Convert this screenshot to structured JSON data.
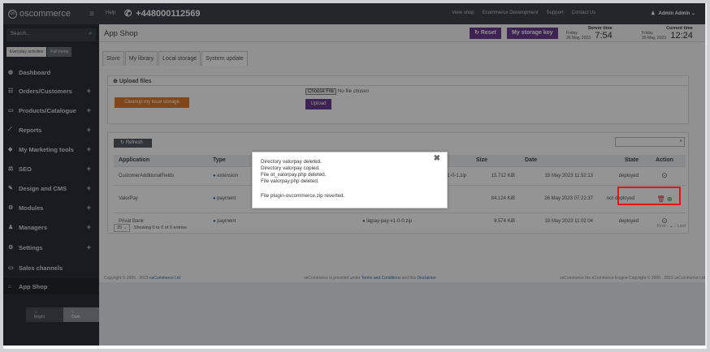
{
  "topbar": {
    "brand": "oscommerce",
    "logo": "os",
    "help": "Help",
    "phone": "+448000112569",
    "links": [
      "View shop",
      "Ecommerce Development",
      "Support",
      "Contact Us"
    ],
    "user": "Admin Admin"
  },
  "sidebar": {
    "search_placeholder": "Search...",
    "modes": [
      "Everyday activities",
      "Full menu"
    ],
    "items": [
      {
        "label": "Dashboard",
        "has_plus": false
      },
      {
        "label": "Orders/Customers",
        "has_plus": true
      },
      {
        "label": "Products/Catalogue",
        "has_plus": true
      },
      {
        "label": "Reports",
        "has_plus": true
      },
      {
        "label": "My Marketing tools",
        "has_plus": true
      },
      {
        "label": "SEO",
        "has_plus": true
      },
      {
        "label": "Design and CMS",
        "has_plus": true
      },
      {
        "label": "Modules",
        "has_plus": true
      },
      {
        "label": "Managers",
        "has_plus": true
      },
      {
        "label": "Settings",
        "has_plus": true
      },
      {
        "label": "Sales channels",
        "has_plus": false
      },
      {
        "label": "App Shop",
        "has_plus": false
      }
    ],
    "theme": {
      "bright": "Bright",
      "dark": "Dark"
    }
  },
  "page": {
    "title": "App Shop",
    "reset_label": "Reset",
    "storage_label": "My storage key",
    "server_time": {
      "label": "Server time",
      "day": "Friday",
      "date": "26 May, 2023",
      "time": "7:54"
    },
    "current_time": {
      "label": "Current time",
      "day": "Friday",
      "date": "26 May, 2023",
      "time": "12:24"
    }
  },
  "tabs": [
    "Store",
    "My library",
    "Local storage",
    "System update"
  ],
  "upload": {
    "heading": "Upload files",
    "cleanup_label": "Cleanup my local storage",
    "choose_label": "Choose File",
    "no_file": "No file chosen",
    "upload_label": "Upload"
  },
  "table": {
    "refresh_label": "Refresh",
    "columns": [
      "Application",
      "Type",
      "",
      "",
      "Size",
      "Date",
      "State",
      "Action"
    ],
    "rows": [
      {
        "application": "CustomerAdditionalFields",
        "type": "extension",
        "file": "s-ext-v1-0-1.zip",
        "size": "15.712 KiB",
        "date": "19 May 2023 11:52:13",
        "state": "deployed"
      },
      {
        "application": "ValorPay",
        "type": "payment",
        "file": "",
        "size": "84.124 KiB",
        "date": "26 May 2023 07:22:37",
        "state": "not deployed"
      },
      {
        "application": "Privat Bank",
        "type": "payment",
        "file": "liqpay-pay-v1-0-0.zip",
        "size": "9.574 KiB",
        "date": "19 May 2023 11:02:04",
        "state": "deployed"
      }
    ],
    "page_size": "25",
    "showing": "Showing 0 to 0 of 0 entries",
    "first": "First",
    "last": "Last"
  },
  "footer": {
    "copyright": "Copyright © 2005 - 2023",
    "copyright_link": "osCommerce Ltd",
    "provided_pre": "osCommerce is provided under",
    "terms_link": "Terms and Conditions",
    "provided_mid": "and this",
    "disclaimer_link": "Disclaimer",
    "right": "osCommerce the eCommerce Engine Copyright © 2000 - 2023 osCommerce Ltd"
  },
  "modal": {
    "lines": [
      "Directory valorpay deleted.",
      "Directory valorpay copied.",
      "File ot_valorpay.php deleted.",
      "File valorpay.php deleted.",
      "",
      "File plugin-oscommerce.zip reverted."
    ]
  }
}
